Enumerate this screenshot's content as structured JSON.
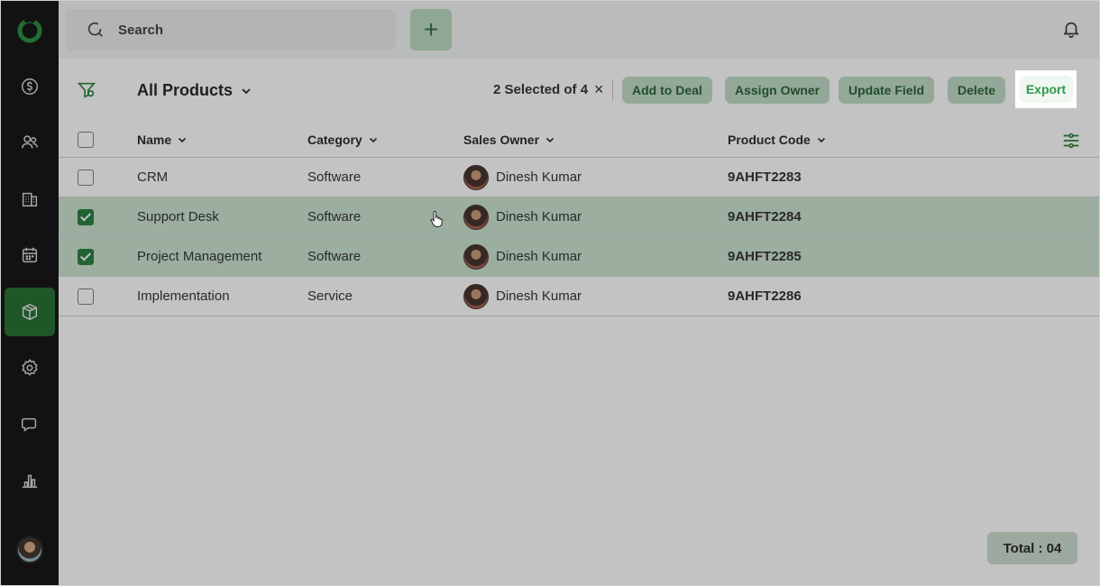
{
  "colors": {
    "sidebar_bg": "#0b0b0b",
    "accent_green": "#1f7a35",
    "selected_row": "#c8e2cf"
  },
  "sidebar": {
    "items": [
      {
        "icon": "deals-dollar-icon"
      },
      {
        "icon": "contacts-icon"
      },
      {
        "icon": "company-building-icon"
      },
      {
        "icon": "calendar-icon"
      },
      {
        "icon": "products-box-icon",
        "active": true
      },
      {
        "icon": "settings-gear-icon"
      },
      {
        "icon": "chat-icon"
      },
      {
        "icon": "reports-chart-icon"
      }
    ]
  },
  "topbar": {
    "search_placeholder": "Search",
    "add_label": "+"
  },
  "toolbar": {
    "view_title": "All Products",
    "selection_text": "2 Selected of 4",
    "clear_selection": "×",
    "actions": [
      "Add to Deal",
      "Assign Owner",
      "Update Field",
      "Delete"
    ],
    "export_label": "Export"
  },
  "table": {
    "headers": {
      "name": "Name",
      "category": "Category",
      "owner": "Sales Owner",
      "code": "Product Code"
    },
    "rows": [
      {
        "name": "CRM",
        "category": "Software",
        "owner": "Dinesh Kumar",
        "code": "9AHFT2283",
        "checked": false
      },
      {
        "name": "Support Desk",
        "category": "Software",
        "owner": "Dinesh Kumar",
        "code": "9AHFT2284",
        "checked": true
      },
      {
        "name": "Project Management",
        "category": "Software",
        "owner": "Dinesh Kumar",
        "code": "9AHFT2285",
        "checked": true
      },
      {
        "name": "Implementation",
        "category": "Service",
        "owner": "Dinesh Kumar",
        "code": "9AHFT2286",
        "checked": false
      }
    ]
  },
  "footer": {
    "total_label": "Total : 04"
  }
}
